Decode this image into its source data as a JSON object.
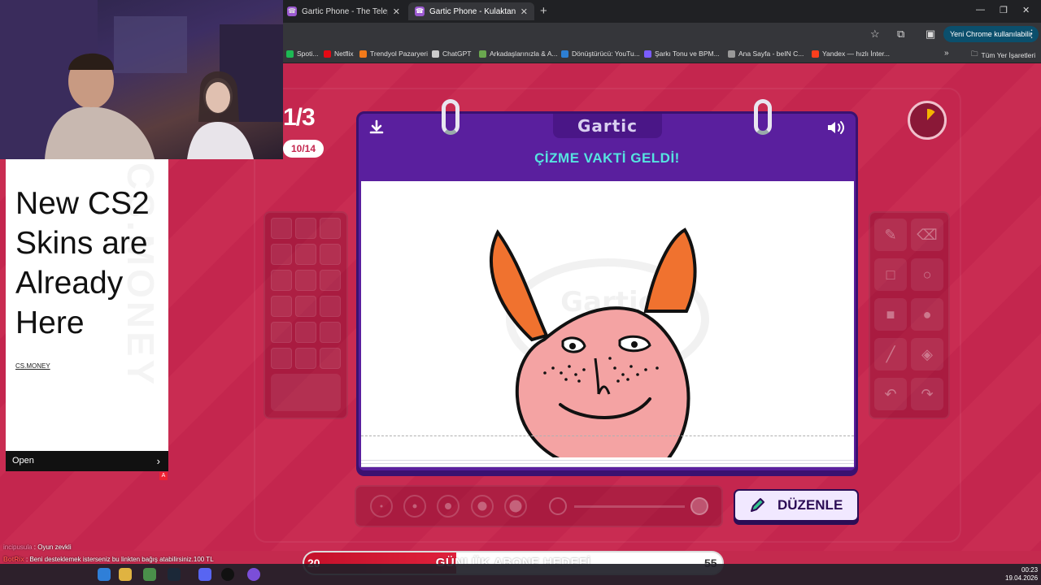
{
  "browser": {
    "tabs": [
      {
        "title": "Gartic Phone - The Telephone G",
        "active": false
      },
      {
        "title": "Gartic Phone - Kulaktan Kulağa",
        "active": true
      }
    ],
    "new_tab": "+",
    "update_button": "Yeni Chrome kullanılabilir",
    "bookmarks": [
      {
        "label": "Spoti...",
        "color": "#1db954"
      },
      {
        "label": "Netflix",
        "color": "#e50914"
      },
      {
        "label": "Trendyol Pazaryeri",
        "color": "#f27a1a"
      },
      {
        "label": "ChatGPT",
        "color": "#cccccc"
      },
      {
        "label": "Arkadaşlarınızla & A...",
        "color": "#6aa84f"
      },
      {
        "label": "Dönüştürücü: YouTu...",
        "color": "#2d7fd3"
      },
      {
        "label": "Şarkı Tonu ve BPM...",
        "color": "#7a5cff"
      },
      {
        "label": "Ana Sayfa - beIN C...",
        "color": "#999999"
      },
      {
        "label": "Yandex — hızlı İnter...",
        "color": "#fc3f1d"
      }
    ],
    "all_bookmarks": "Tüm Yer İşaretleri"
  },
  "game": {
    "round": "1/3",
    "players": "10/14",
    "logo": "Gartic",
    "instruction": "ÇİZME VAKTİ GELDİ!",
    "edit_button": "DÜZENLE",
    "timer_fraction_elapsed": 0.12,
    "colors": {
      "background": "#c4264e",
      "book": "#5a1f9e",
      "instruction": "#56e3e0",
      "drawing_face": "#f4a3a3",
      "drawing_ears": "#f0722f"
    }
  },
  "ad": {
    "title": "New CS2 Skins are Already Here",
    "link": "CS.MONEY",
    "watermark": "CS.MONEY",
    "open": "Open"
  },
  "chat": [
    {
      "user": "incipusula",
      "message": " : Oyun zevkli"
    },
    {
      "user": "BotRix",
      "message": " : Beni desteklemek isterseniz bu linkten bağış atabilirsiniz.100 TL"
    }
  ],
  "sub_goal": {
    "title": "GÜNLÜK ABONE HEDEFİ",
    "current": "20",
    "target": "55",
    "progress_fraction": 0.364
  },
  "taskbar": {
    "time": "00:23",
    "date": "19.04.2026"
  }
}
